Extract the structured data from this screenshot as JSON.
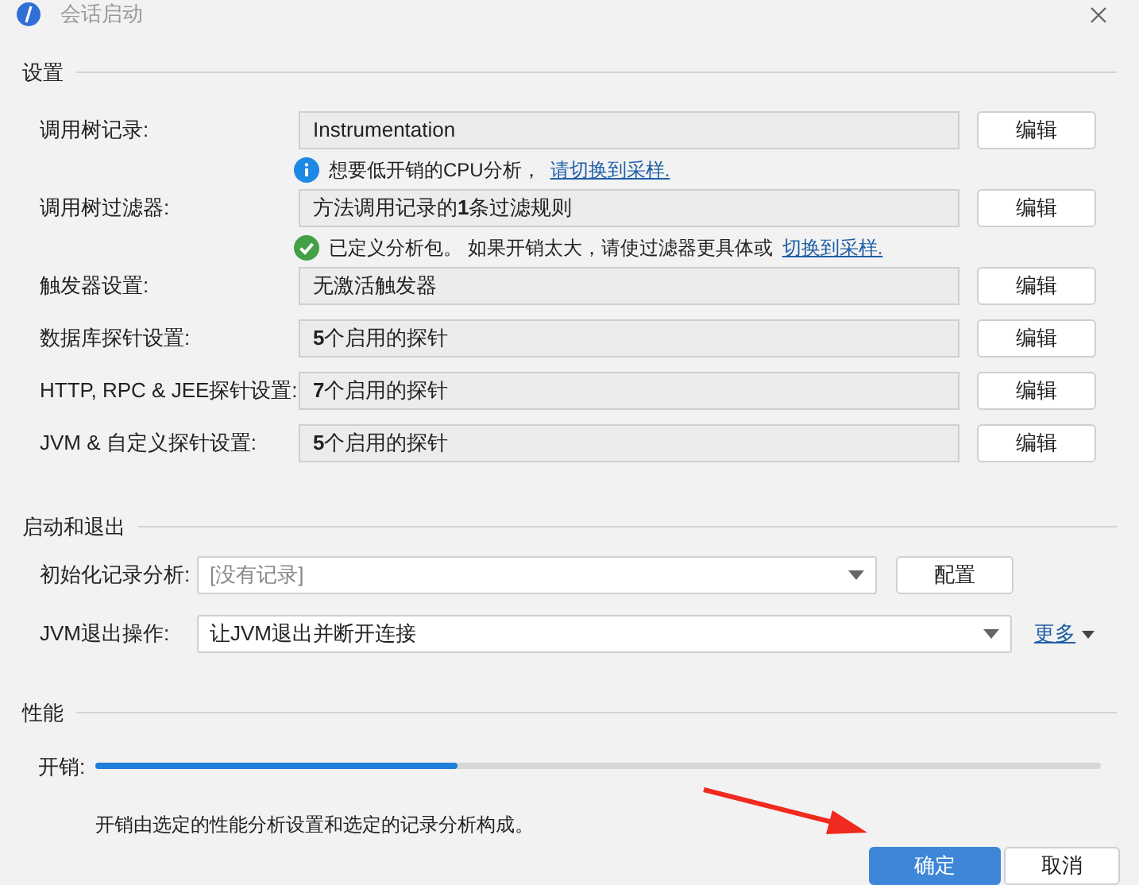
{
  "window": {
    "title": "会话启动"
  },
  "settings": {
    "title": "设置",
    "rows": [
      {
        "kind": "field",
        "label": "调用树记录:",
        "value": "Instrumentation",
        "button": "编辑"
      },
      {
        "kind": "info",
        "text": "想要低开销的CPU分析，",
        "link": "请切换到采样."
      },
      {
        "kind": "field",
        "label": "调用树过滤器:",
        "value": "方法调用记录的**1**条过滤规则",
        "button": "编辑"
      },
      {
        "kind": "success",
        "text": "已定义分析包。 如果开销太大，请使过滤器更具体或",
        "link": "切换到采样."
      },
      {
        "kind": "field",
        "label": "触发器设置:",
        "value": "无激活触发器",
        "button": "编辑"
      },
      {
        "kind": "field",
        "label": "数据库探针设置:",
        "value": "**5**个启用的探针",
        "button": "编辑"
      },
      {
        "kind": "field",
        "label": "HTTP, RPC & JEE探针设置:",
        "value": "**7**个启用的探针",
        "button": "编辑"
      },
      {
        "kind": "field",
        "label": "JVM & 自定义探针设置:",
        "value": "**5**个启用的探针",
        "button": "编辑"
      }
    ]
  },
  "startup": {
    "title": "启动和退出",
    "init": {
      "label": "初始化记录分析:",
      "placeholder": "[没有记录]",
      "button": "配置"
    },
    "exit": {
      "label": "JVM退出操作:",
      "value": "让JVM退出并断开连接",
      "more": "更多"
    }
  },
  "performance": {
    "title": "性能",
    "overhead": {
      "label": "开销:",
      "level": 0.36
    },
    "note": "开销由选定的性能分析设置和选定的记录分析构成。"
  },
  "buttons": [
    {
      "label": "确定",
      "primary": true
    },
    {
      "label": "取消",
      "primary": false
    }
  ]
}
